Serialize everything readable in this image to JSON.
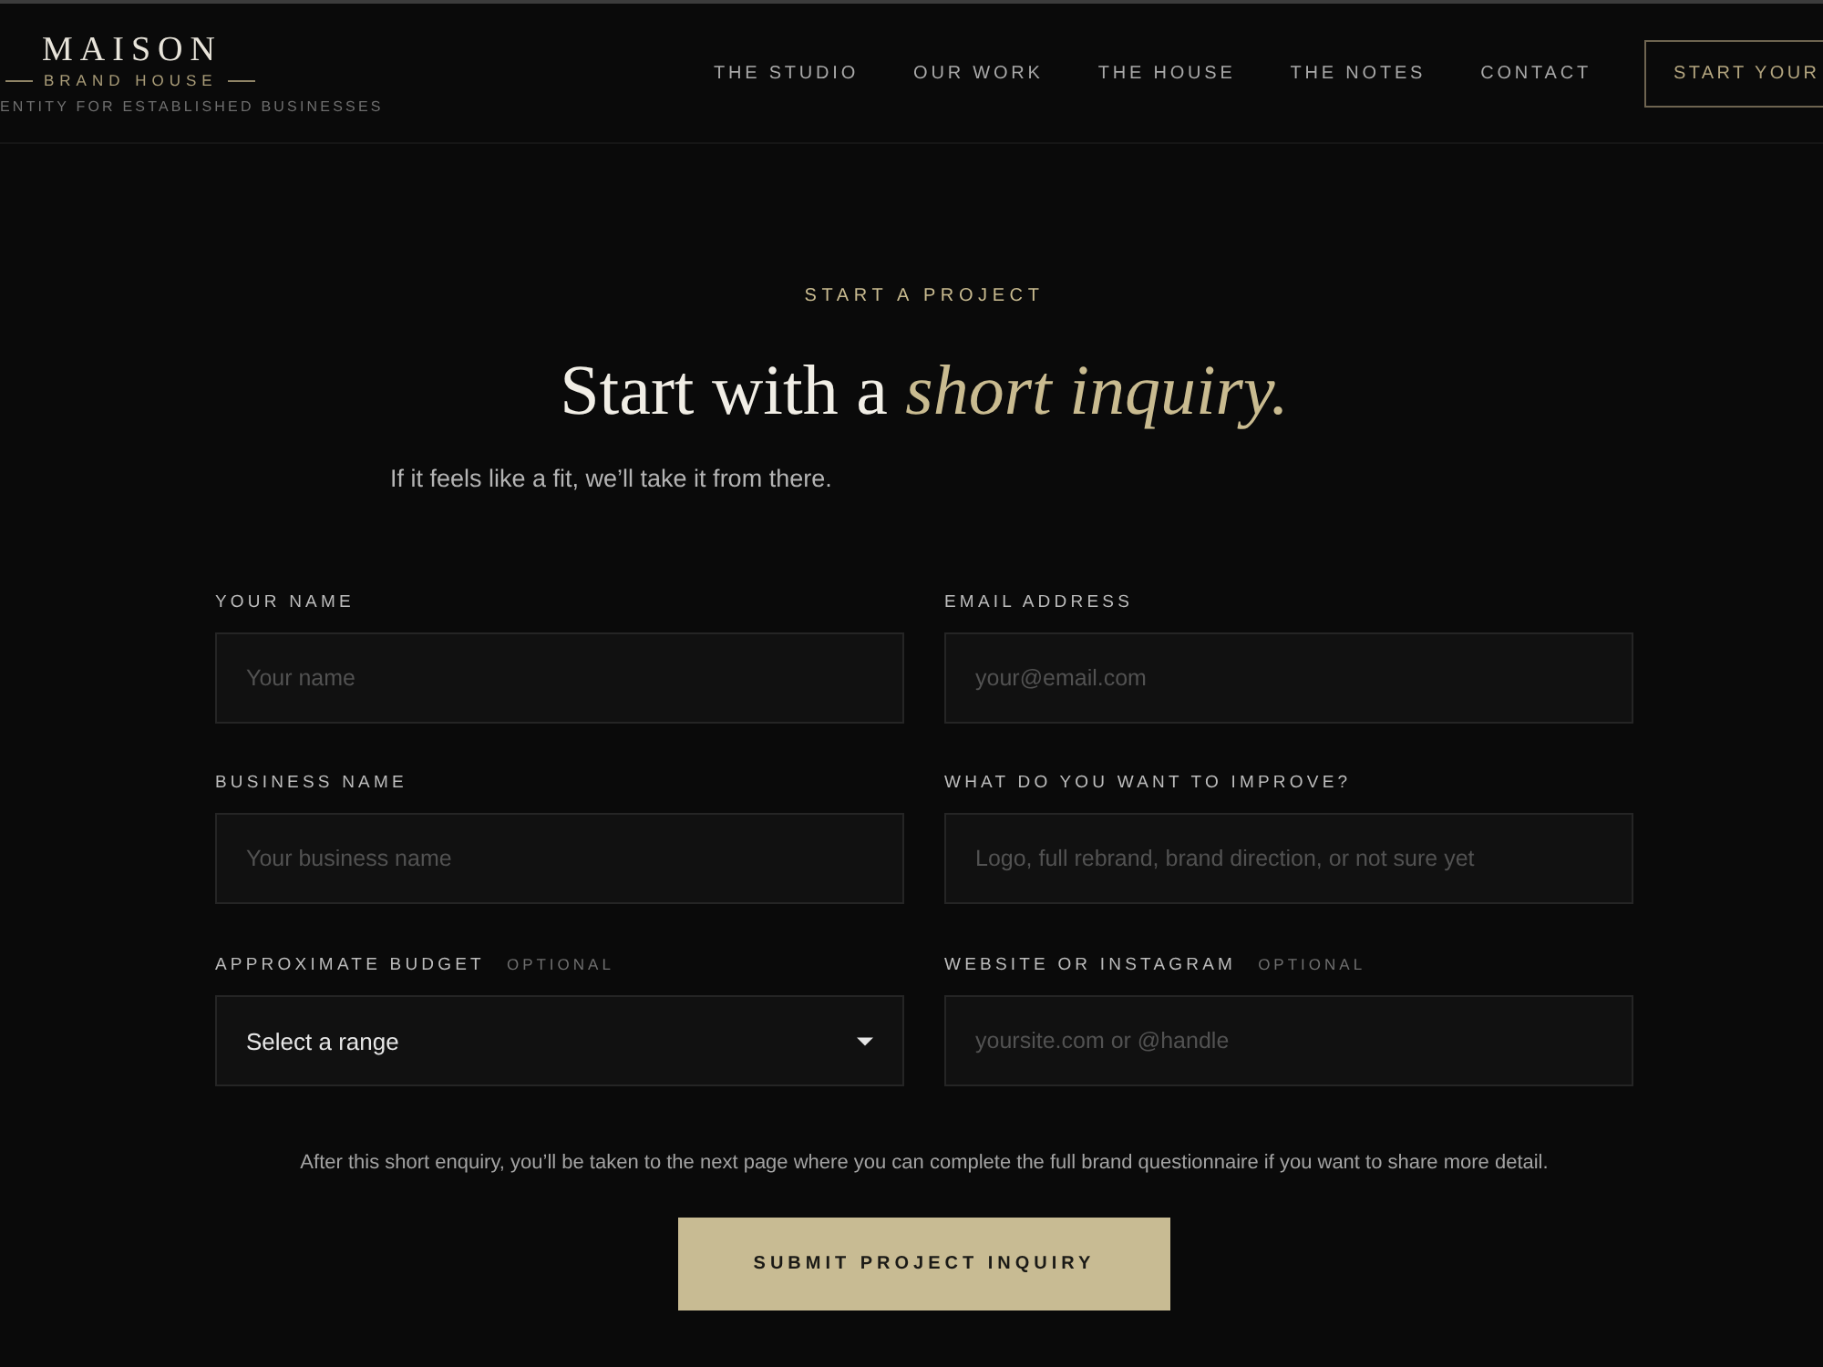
{
  "header": {
    "logo": {
      "name": "MAISON",
      "subtitle": "BRAND HOUSE",
      "tagline": "ENTITY FOR ESTABLISHED BUSINESSES"
    },
    "nav": [
      {
        "label": "THE STUDIO"
      },
      {
        "label": "OUR WORK"
      },
      {
        "label": "THE HOUSE"
      },
      {
        "label": "THE NOTES"
      },
      {
        "label": "CONTACT"
      }
    ],
    "cta": "START YOUR"
  },
  "intro": {
    "eyebrow": "START A PROJECT",
    "heading": "Start with a *short inquiry.*",
    "subtitle": "If it feels like a fit, we’ll take it from there."
  },
  "form": {
    "fields": [
      {
        "kind": "text",
        "label": "YOUR NAME",
        "placeholder": "Your name"
      },
      {
        "kind": "text",
        "label": "EMAIL ADDRESS",
        "placeholder": "your@email.com"
      },
      {
        "kind": "text",
        "label": "BUSINESS NAME",
        "placeholder": "Your business name"
      },
      {
        "kind": "text",
        "label": "WHAT DO YOU WANT TO IMPROVE?",
        "placeholder": "Logo, full rebrand, brand direction, or not sure yet"
      },
      {
        "kind": "select",
        "label": "APPROXIMATE BUDGET",
        "tag": "OPTIONAL",
        "value": "Select a range"
      },
      {
        "kind": "text",
        "label": "WEBSITE OR INSTAGRAM",
        "tag": "OPTIONAL",
        "placeholder": "yoursite.com or @handle"
      }
    ],
    "note": "After this short enquiry, you’ll be taken to the next page where you can complete the full brand questionnaire if you want to share more detail.",
    "submit": "SUBMIT PROJECT INQUIRY"
  }
}
